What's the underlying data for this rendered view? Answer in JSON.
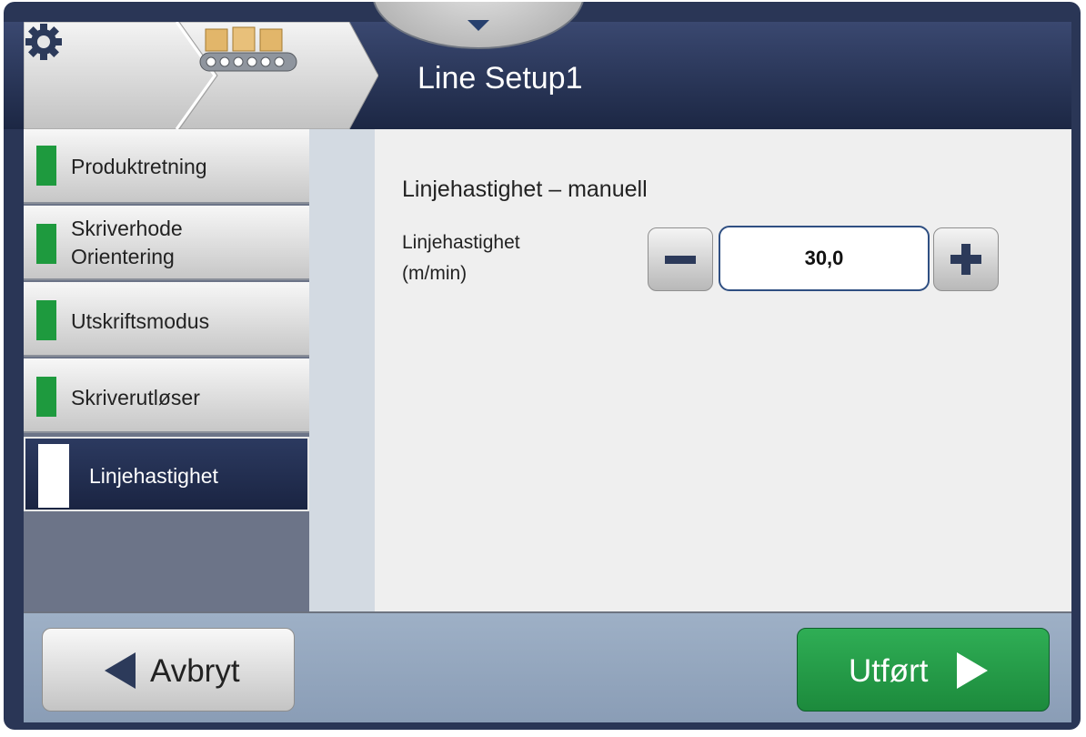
{
  "header": {
    "title": "Line Setup1",
    "breadcrumb": [
      {
        "icon": "gear-icon"
      },
      {
        "icon": "conveyor-icon"
      }
    ]
  },
  "sidebar": {
    "items": [
      {
        "label": "Produktretning",
        "status": "complete"
      },
      {
        "label": "Skriverhode Orientering",
        "status": "complete"
      },
      {
        "label": "Utskriftsmodus",
        "status": "complete"
      },
      {
        "label": "Skriverutløser",
        "status": "complete"
      },
      {
        "label": "Linjehastighet",
        "status": "active"
      }
    ]
  },
  "content": {
    "section_title": "Linjehastighet – manuell",
    "field_label": "Linjehastighet (m/min)",
    "field_value": "30,0"
  },
  "footer": {
    "cancel_label": "Avbryt",
    "done_label": "Utført"
  },
  "colors": {
    "header": "#1c2744",
    "check": "#1e9a3e",
    "done_button": "#1c8a3c",
    "accent": "#2f4f82"
  }
}
